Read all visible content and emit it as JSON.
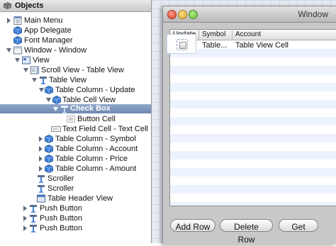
{
  "objects_panel": {
    "title": "Objects",
    "items": [
      {
        "label": "Main Menu",
        "icon": "menu-icon"
      },
      {
        "label": "App Delegate",
        "icon": "cube-blue-icon"
      },
      {
        "label": "Font Manager",
        "icon": "cube-blue-icon"
      },
      {
        "label": "Window - Window",
        "icon": "window-icon"
      },
      {
        "label": "View",
        "icon": "view-icon"
      },
      {
        "label": "Scroll View - Table View",
        "icon": "scroll-view-icon"
      },
      {
        "label": "Table View",
        "icon": "table-view-icon"
      },
      {
        "label": "Table Column - Update",
        "icon": "cube-blue-icon"
      },
      {
        "label": "Table Cell View",
        "icon": "cube-blue-icon"
      },
      {
        "label": "Check Box",
        "icon": "button-cube-icon"
      },
      {
        "label": "Button Cell",
        "icon": "cell-icon"
      },
      {
        "label": "Text Field Cell - Text Cell",
        "icon": "text-field-icon"
      },
      {
        "label": "Table Column - Symbol",
        "icon": "cube-blue-icon"
      },
      {
        "label": "Table Column - Account",
        "icon": "cube-blue-icon"
      },
      {
        "label": "Table Column - Price",
        "icon": "cube-blue-icon"
      },
      {
        "label": "Table Column - Amount",
        "icon": "cube-blue-icon"
      },
      {
        "label": "Scroller",
        "icon": "button-cube-icon"
      },
      {
        "label": "Scroller",
        "icon": "button-cube-icon"
      },
      {
        "label": "Table Header View",
        "icon": "header-view-icon"
      },
      {
        "label": "Push Button",
        "icon": "button-cube-icon"
      },
      {
        "label": "Push Button",
        "icon": "button-cube-icon"
      },
      {
        "label": "Push Button",
        "icon": "button-cube-icon"
      }
    ]
  },
  "window": {
    "title": "Window",
    "table": {
      "columns": [
        "Update",
        "Symbol",
        "Account"
      ],
      "rows": [
        {
          "symbol": "Table...",
          "account": "Table View Cell"
        }
      ]
    },
    "buttons": {
      "add_row": "Add Row",
      "delete_row": "Delete Row",
      "get": "Get"
    }
  },
  "colors": {
    "selection": "#7a92b8",
    "alt_row": "#edf3fe",
    "grid_bg": "#e6ebf2"
  }
}
